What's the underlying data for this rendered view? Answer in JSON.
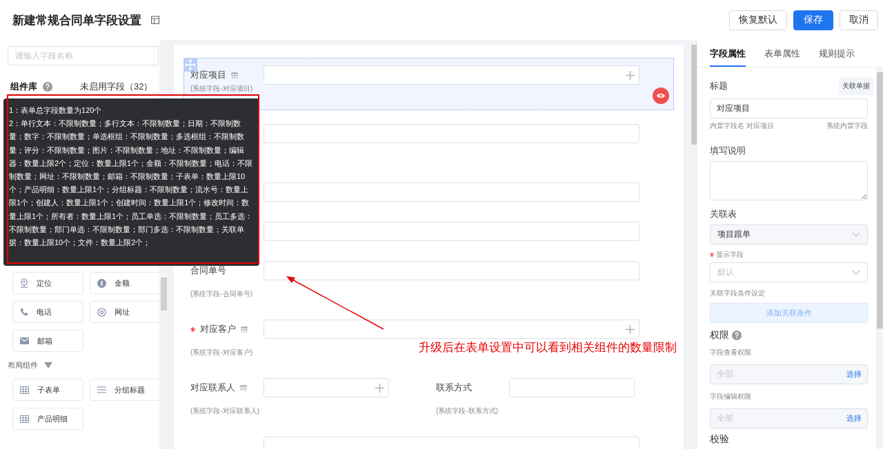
{
  "header": {
    "title": "新建常规合同单字段设置",
    "buttons": [
      {
        "label": "恢复默认",
        "kind": "default"
      },
      {
        "label": "保存",
        "kind": "primary"
      },
      {
        "label": "取消",
        "kind": "default"
      }
    ]
  },
  "components_panel": {
    "search": {
      "placeholder": "请输入字段名称"
    },
    "tabs": [
      {
        "label": "组件库",
        "selected": true,
        "help": true
      },
      {
        "label": "未启用字段（32）",
        "selected": false,
        "help": false
      }
    ],
    "tooltip": {
      "lines": [
        "1：表单总字段数量为120个",
        "2：单行文本：不限制数量；多行文本：不限制数量；日期：不限制数量；数字：不限制数量；单选框组：不限制数量；多选框组：不限制数量；评分：不限制数量；图片：不限制数量；地址：不限制数量；编辑器：数量上限2个；定位：数量上限1个；金额：不限制数量；电话：不限制数量；网址：不限制数量；邮箱：不限制数量；子表单：数量上限10个；产品明细：数量上限1个；分组标题：不限制数量；流水号：数量上限1个；创建人：数量上限1个；创建时间：数量上限1个；修改时间：数量上限1个；所有者：数量上限1个；员工单选：不限制数量；员工多选：不限制数量；部门单选：不限制数量；部门多选：不限制数量；关联单据：数量上限10个；文件：数量上限2个；"
      ]
    },
    "groups": [
      {
        "items": [
          {
            "label": "定位",
            "kind": "location"
          },
          {
            "label": "金额",
            "kind": "amount"
          },
          {
            "label": "电话",
            "kind": "phone"
          },
          {
            "label": "网址",
            "kind": "url"
          },
          {
            "label": "邮箱",
            "kind": "email"
          }
        ]
      },
      {
        "title": "布局组件",
        "expanded": true,
        "items": [
          {
            "label": "子表单",
            "kind": "table"
          },
          {
            "label": "分组标题",
            "kind": "group-title"
          },
          {
            "label": "产品明细",
            "kind": "table"
          }
        ]
      }
    ]
  },
  "form": {
    "rows": [
      {
        "fields": [
          {
            "label": "对应项目",
            "hint": "(系统字段-对应项目)",
            "kind": "relation",
            "required": false,
            "selected": true
          }
        ]
      },
      {
        "fields": [
          {
            "kind": "text",
            "selected": false
          }
        ]
      },
      {
        "fields": [
          {
            "kind": "text",
            "selected": false
          }
        ]
      },
      {
        "fields": [
          {
            "kind": "text",
            "selected": false
          }
        ]
      },
      {
        "fields": [
          {
            "label": "合同单号",
            "hint": "(系统字段-合同单号)",
            "kind": "text",
            "required": false,
            "selected": false
          }
        ]
      },
      {
        "fields": [
          {
            "label": "对应客户",
            "hint": "(系统字段-对应客户)",
            "kind": "relation",
            "required": true,
            "selected": false
          }
        ]
      },
      {
        "fields": [
          {
            "label": "对应联系人",
            "hint": "(系统字段-对应联系人)",
            "kind": "relation",
            "required": false,
            "selected": false
          },
          {
            "label": "联系方式",
            "hint": "(系统字段-联系方式)",
            "kind": "text",
            "required": false,
            "selected": false
          }
        ]
      },
      {
        "fields": [
          {
            "kind": "text",
            "required": false,
            "selected": false
          }
        ]
      }
    ]
  },
  "properties": {
    "tabs": [
      {
        "label": "字段属性",
        "selected": true
      },
      {
        "label": "表单属性",
        "selected": false
      },
      {
        "label": "规则提示",
        "selected": false
      }
    ],
    "title_label": "标题",
    "link_button": "关联单据",
    "title_value": "对应项目",
    "builtin_name": "内置字段名 对应项目",
    "builtin_tag": "系统内置字段",
    "description_label": "填写说明",
    "related_table_label": "关联表",
    "related_table_value": "项目跟单",
    "display_field_label": "显示字段",
    "display_field_required": true,
    "display_field_placeholder": "默认",
    "condition_label": "关联字段条件设定",
    "condition_button": "添加关联条件",
    "permissions_title": "权限",
    "view_permission_label": "字段查看权限",
    "view_permission_placeholder": "全部",
    "view_permission_action": "选择",
    "edit_permission_label": "字段编辑权限",
    "edit_permission_placeholder": "全部",
    "edit_permission_action": "选择",
    "validation_title": "校验"
  },
  "annotation": {
    "text": "升级后在表单设置中可以看到相关组件的数量限制"
  }
}
